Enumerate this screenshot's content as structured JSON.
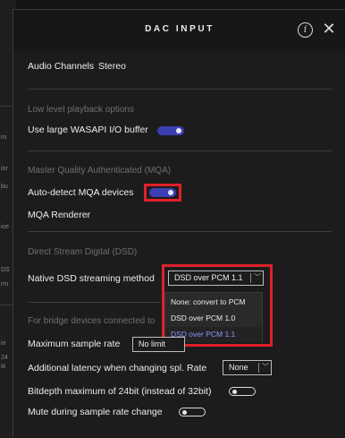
{
  "background": {
    "fragments": [
      "ro",
      "ior",
      "bu",
      "ice",
      "DS",
      "rm",
      "in",
      "24",
      "iti"
    ]
  },
  "dialog": {
    "title": "DAC INPUT",
    "info_icon": "info-circle-icon",
    "close_icon": "close-x-icon",
    "audio_channels": {
      "label": "Audio Channels",
      "value": "Stereo"
    },
    "low_level": {
      "heading": "Low level playback options",
      "large_buffer": {
        "label": "Use large WASAPI I/O buffer",
        "state": "on"
      }
    },
    "mqa": {
      "heading": "Master Quality Authenticated (MQA)",
      "auto_detect": {
        "label": "Auto-detect MQA devices",
        "state": "on"
      },
      "renderer": {
        "label": "MQA Renderer"
      }
    },
    "dsd": {
      "heading": "Direct Stream Digital (DSD)",
      "method": {
        "label": "Native DSD streaming method",
        "selected": "DSD over PCM 1.1",
        "options": [
          "None: convert to PCM",
          "DSD over PCM 1.0",
          "DSD over PCM 1.1"
        ]
      }
    },
    "bridge": {
      "heading": "For bridge devices connected to",
      "max_rate": {
        "label": "Maximum sample rate",
        "value": "No limit"
      },
      "latency": {
        "label": "Additional latency when changing spl. Rate",
        "value": "None"
      },
      "bitdepth": {
        "label": "Bitdepth maximum of 24bit (instead of 32bit)",
        "state": "off"
      },
      "mute": {
        "label": "Mute during sample rate change",
        "state": "off"
      }
    }
  },
  "colors": {
    "accent": "#3b3fb3",
    "highlight": "#e0202a",
    "selected_option": "#8f94ff"
  }
}
